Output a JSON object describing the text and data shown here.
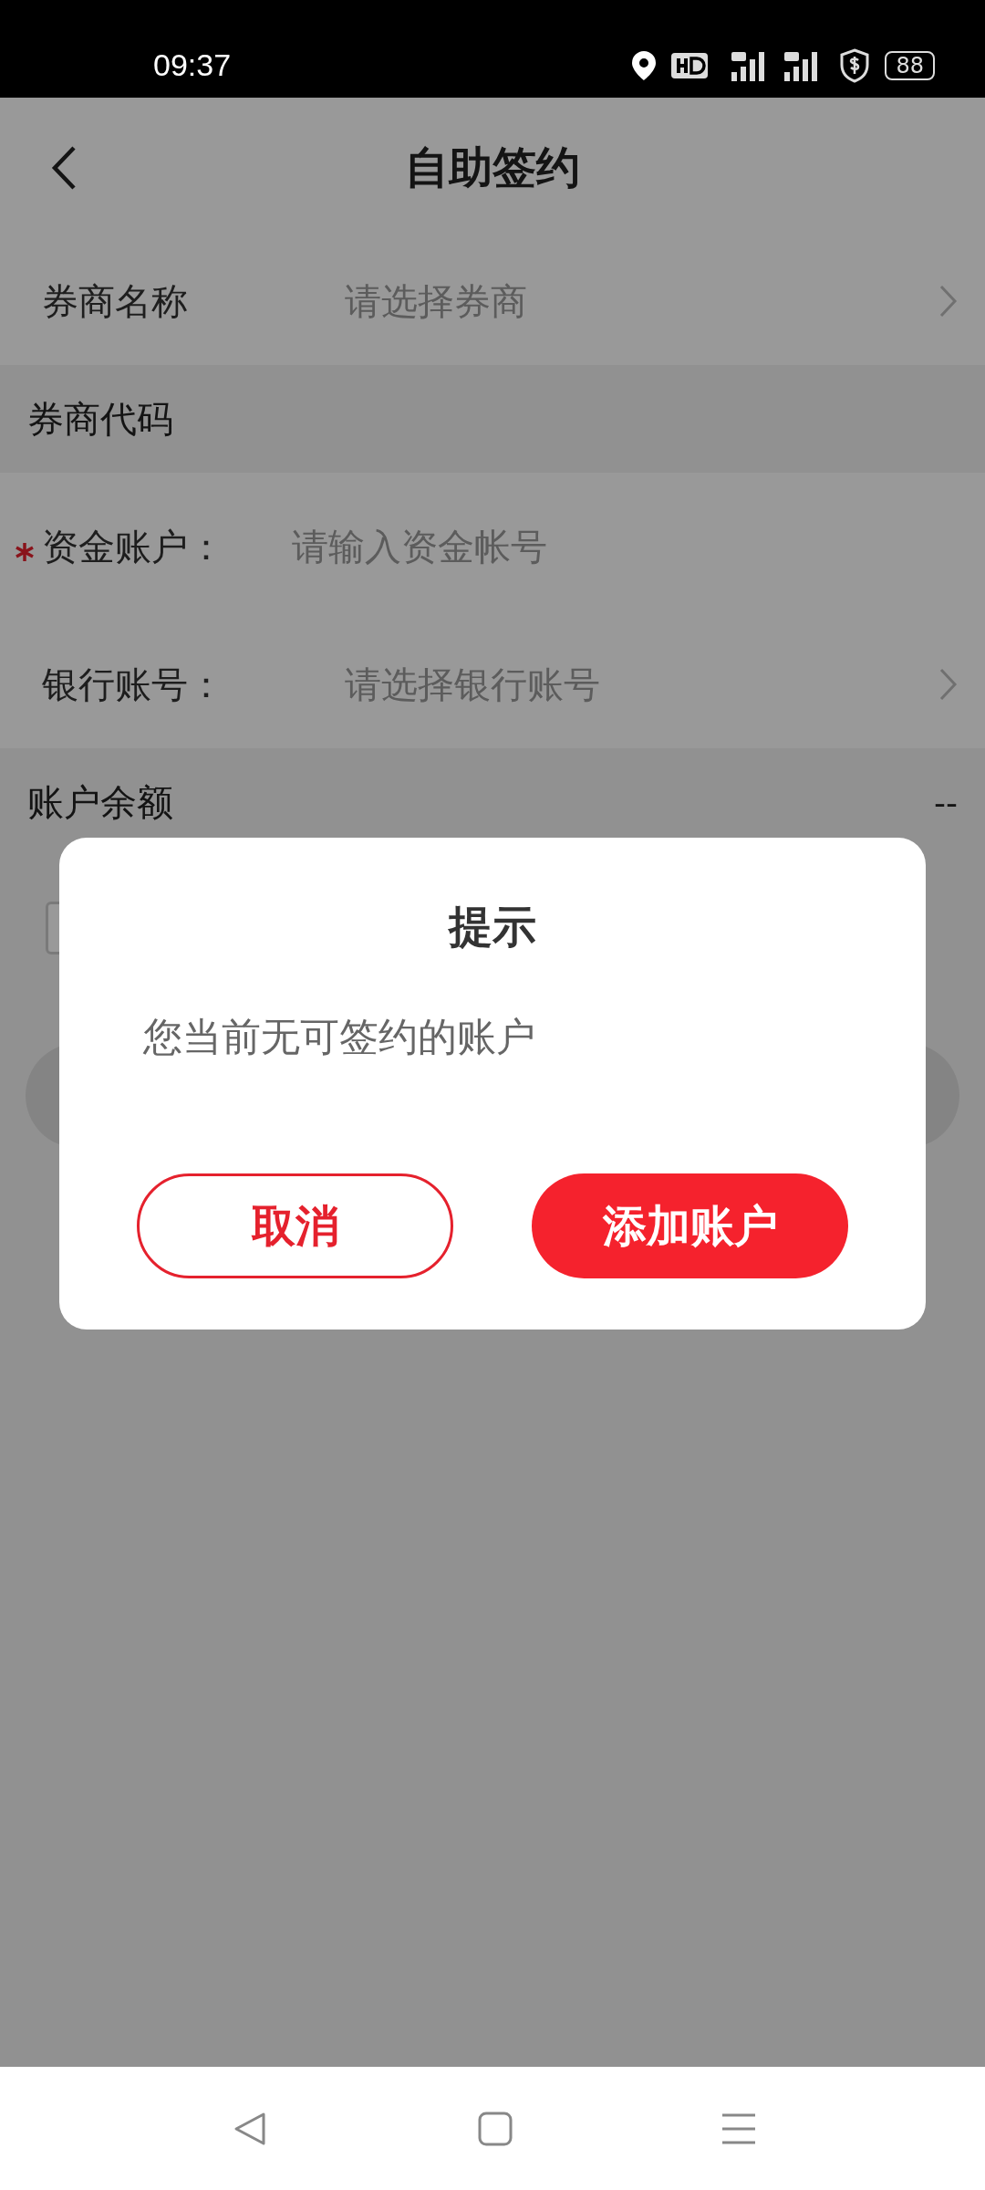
{
  "status_bar": {
    "time": "09:37",
    "battery": "88"
  },
  "header": {
    "title": "自助签约"
  },
  "form": [
    {
      "kind": "select",
      "label": "券商名称",
      "placeholder": "请选择券商",
      "required": false
    },
    {
      "kind": "section",
      "label": "券商代码"
    },
    {
      "kind": "input",
      "label": "资金账户：",
      "placeholder": "请输入资金帐号",
      "required": true
    },
    {
      "kind": "select",
      "label": "银行账号：",
      "placeholder": "请选择银行账号",
      "required": false
    },
    {
      "kind": "section",
      "label": "账户余额",
      "value": "--"
    }
  ],
  "agreement": {
    "checked": false
  },
  "dialog": {
    "title": "提示",
    "message": "您当前无可签约的账户",
    "buttons": [
      {
        "kind": "secondary",
        "label": "取消"
      },
      {
        "kind": "primary",
        "label": "添加账户"
      }
    ]
  }
}
